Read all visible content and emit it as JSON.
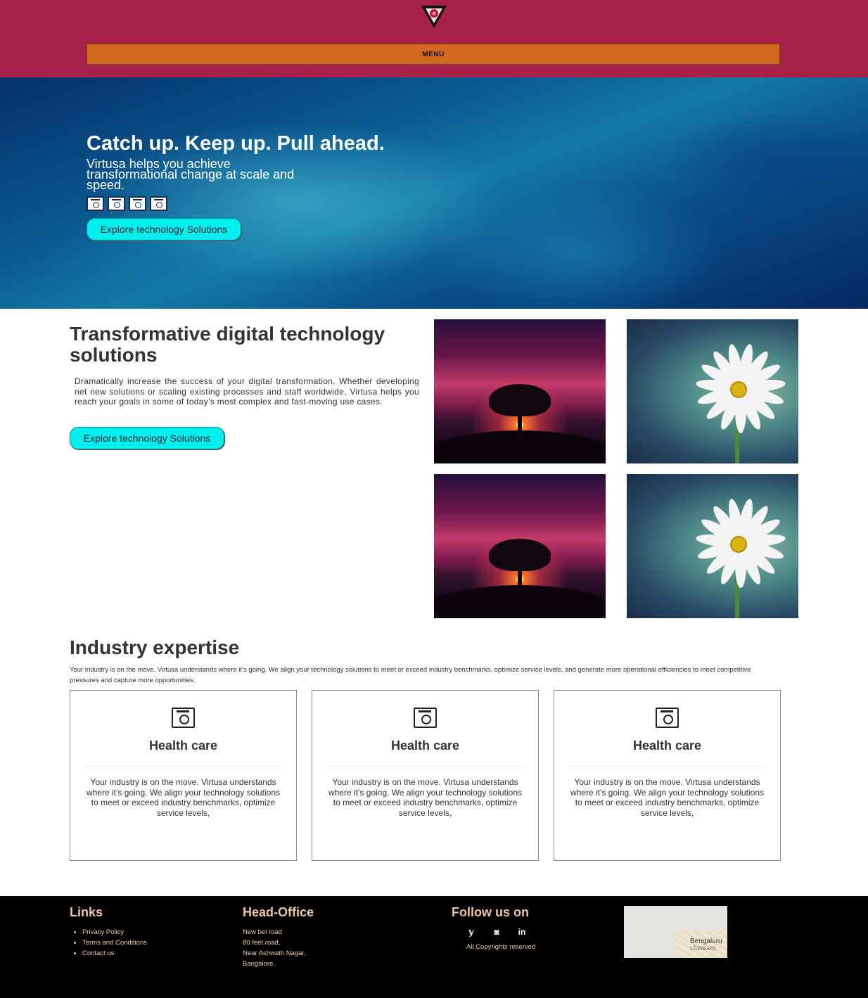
{
  "header": {
    "menu_label": "MENU",
    "colors": {
      "background": "#a8214a",
      "menu_bar": "#d2691e"
    }
  },
  "hero": {
    "title": "Catch up. Keep up. Pull ahead.",
    "subtitle": "Virtusa helps you achieve transformational change at scale and speed.",
    "icons": [
      "camera-icon",
      "camera-icon",
      "camera-icon",
      "camera-icon"
    ],
    "button_label": "Explore technology Solutions"
  },
  "solutions": {
    "title": "Transformative digital technology solutions",
    "text": "Dramatically increase the success of your digital transformation. Whether developing net new solutions or scaling existing processes and staff worldwide, Virtusa helps you reach your goals in some of today’s most complex and fast-moving use cases.",
    "button_label": "Explore technology Solutions"
  },
  "industry": {
    "title": "Industry expertise",
    "text": "Your industry is on the move. Virtusa understands where it’s going. We align your technology solutions to meet or exceed industry benchmarks, optimize service levels, and generate more operational efficiencies to meet competitive pressures and capture more opportunities.",
    "cards": [
      {
        "icon": "camera-icon",
        "title": "Health care",
        "text": "Your industry is on the move. Virtusa understands where it’s going. We align your technology solutions to meet or exceed industry benchmarks, optimize service levels,"
      },
      {
        "icon": "camera-icon",
        "title": "Health care",
        "text": "Your industry is on the move. Virtusa understands where it’s going. We align your technology solutions to meet or exceed industry benchmarks, optimize service levels,"
      },
      {
        "icon": "camera-icon",
        "title": "Health care",
        "text": "Your industry is on the move. Virtusa understands where it’s going. We align your technology solutions to meet or exceed industry benchmarks, optimize service levels,"
      }
    ]
  },
  "footer": {
    "links_heading": "Links",
    "links": [
      "Privacy Policy",
      "Terms and Conditions",
      "Contact us"
    ],
    "office_heading": "Head-Office",
    "address": [
      "New bel road",
      "80 feet road,",
      "Near Ashwath Nagar,",
      "Bangalore."
    ],
    "follow_heading": "Follow us on",
    "social_icons": [
      "twitter-icon",
      "instagram-icon",
      "linkedin-icon"
    ],
    "social_glyphs": [
      "𝕪",
      "◙",
      "in"
    ],
    "copyright": "All Copyrights reserved",
    "map_label": "Bengaluru",
    "map_label_local": "ಬೆಂಗಳೂರು",
    "colors": {
      "text": "#e9c7a5",
      "background": "#000000"
    }
  }
}
